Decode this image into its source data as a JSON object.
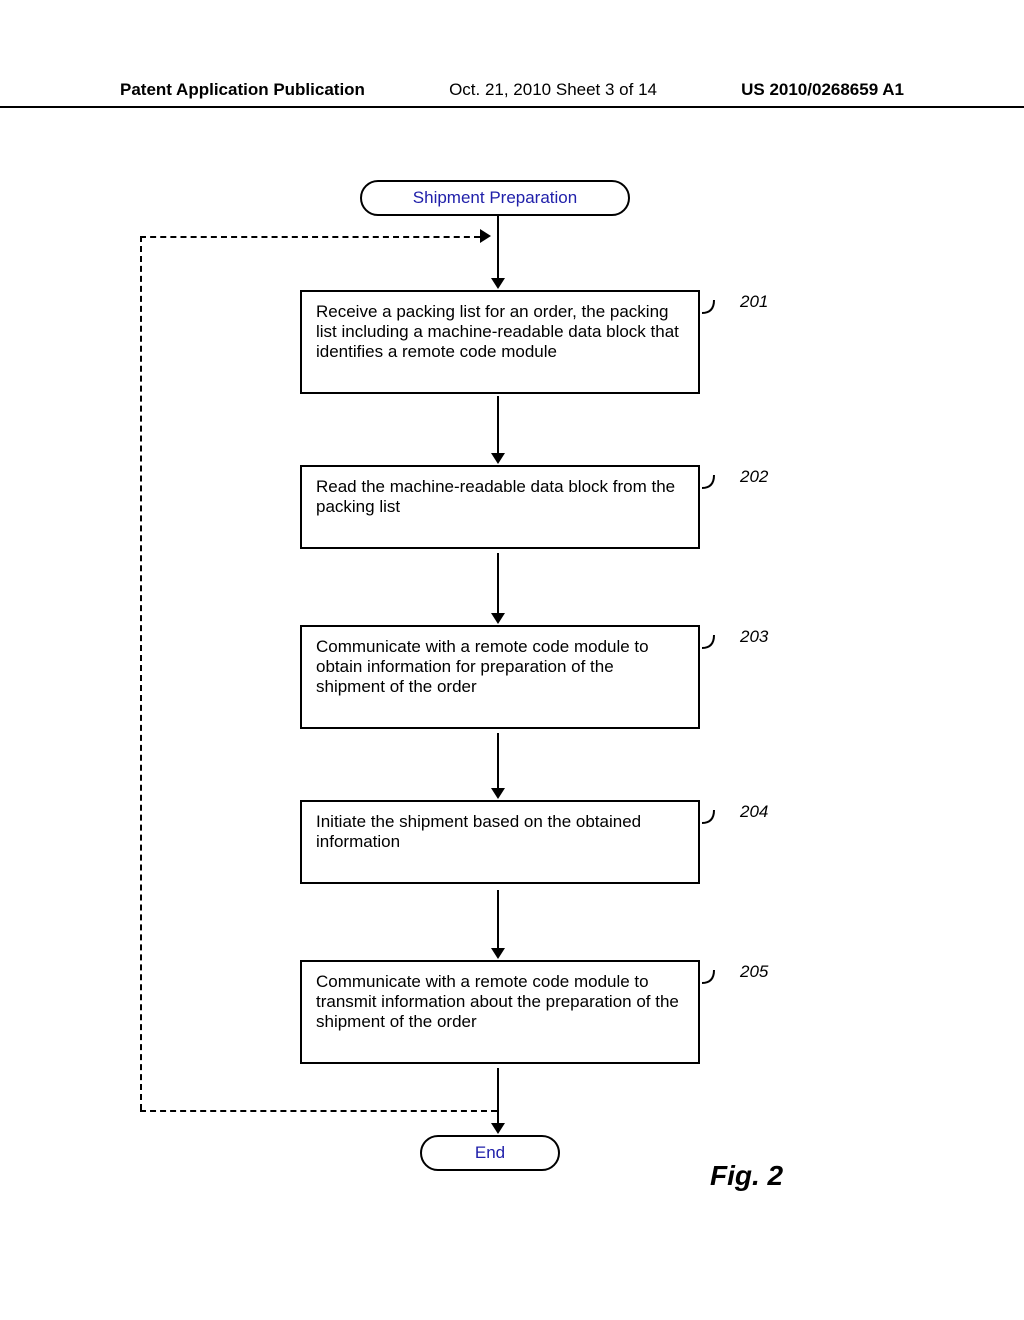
{
  "header": {
    "left": "Patent Application Publication",
    "center": "Oct. 21, 2010   Sheet 3 of 14",
    "right": "US 2010/0268659 A1"
  },
  "flow": {
    "start": "Shipment Preparation",
    "end": "End",
    "steps": [
      {
        "ref": "201",
        "text": "Receive a packing list for an order, the packing list including a machine-readable data block that identifies a remote code module"
      },
      {
        "ref": "202",
        "text": "Read the machine-readable data block from the packing list"
      },
      {
        "ref": "203",
        "text": "Communicate with a remote code module to obtain information for preparation of the shipment of the order"
      },
      {
        "ref": "204",
        "text": "Initiate the shipment based on the obtained information"
      },
      {
        "ref": "205",
        "text": "Communicate with a remote code module to transmit information about the preparation of the shipment of the order"
      }
    ]
  },
  "figure_label": "Fig. 2"
}
